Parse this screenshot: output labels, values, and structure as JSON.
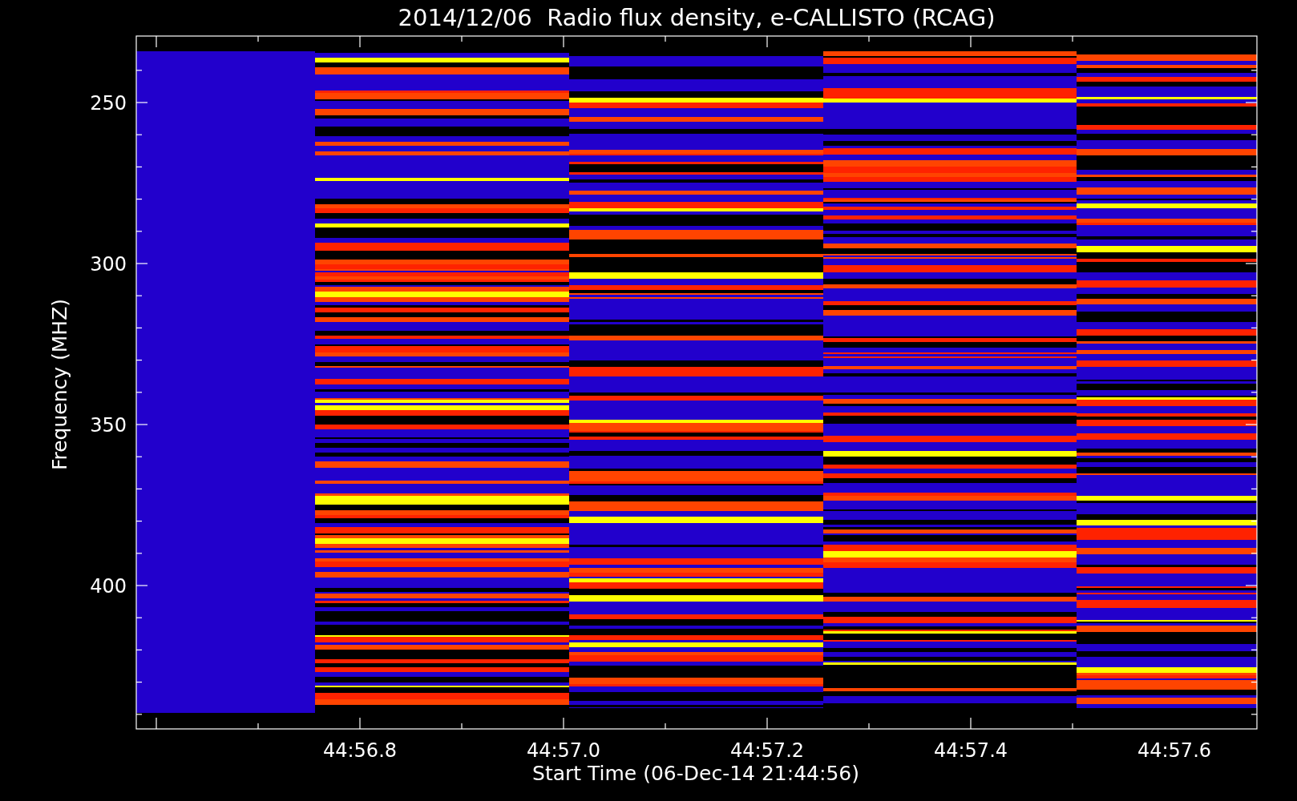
{
  "title": "2014/12/06  Radio flux density, e-CALLISTO (RCAG)",
  "plot": {
    "ylabel": "Frequency (MHZ)",
    "xlabel": "Start Time (06-Dec-14 21:44:56)",
    "ytick_labels": [
      "250",
      "300",
      "350",
      "400"
    ],
    "xtick_labels": [
      "44:56.8",
      "44:57.0",
      "44:57.2",
      "44:57.4",
      "44:57.6"
    ]
  }
}
